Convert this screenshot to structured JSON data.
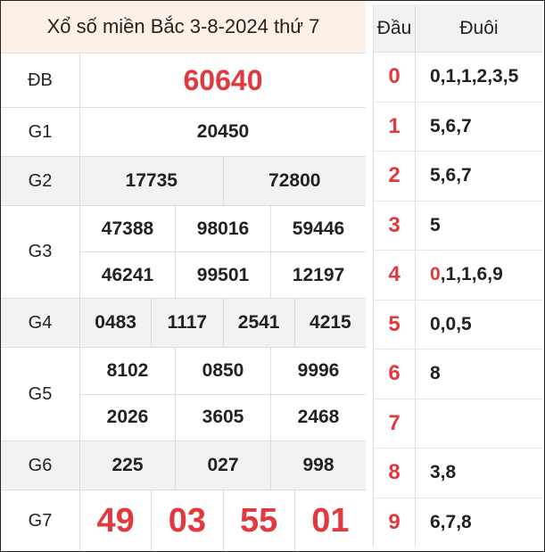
{
  "title": "Xổ số miền Bắc 3-8-2024 thứ 7",
  "prizes": {
    "db": {
      "label": "ĐB",
      "numbers": [
        "60640"
      ]
    },
    "g1": {
      "label": "G1",
      "numbers": [
        "20450"
      ]
    },
    "g2": {
      "label": "G2",
      "numbers": [
        "17735",
        "72800"
      ]
    },
    "g3": {
      "label": "G3",
      "numbers": [
        "47388",
        "98016",
        "59446",
        "46241",
        "99501",
        "12197"
      ]
    },
    "g4": {
      "label": "G4",
      "numbers": [
        "0483",
        "1117",
        "2541",
        "4215"
      ]
    },
    "g5": {
      "label": "G5",
      "numbers": [
        "8102",
        "0850",
        "9996",
        "2026",
        "3605",
        "2468"
      ]
    },
    "g6": {
      "label": "G6",
      "numbers": [
        "225",
        "027",
        "998"
      ]
    },
    "g7": {
      "label": "G7",
      "numbers": [
        "49",
        "03",
        "55",
        "01"
      ]
    }
  },
  "loto": {
    "head_label": "Đầu",
    "tail_label": "Đuôi",
    "rows": [
      {
        "head": "0",
        "tail_highlight": "",
        "tail": "0,1,1,2,3,5"
      },
      {
        "head": "1",
        "tail_highlight": "",
        "tail": "5,6,7"
      },
      {
        "head": "2",
        "tail_highlight": "",
        "tail": "5,6,7"
      },
      {
        "head": "3",
        "tail_highlight": "",
        "tail": "5"
      },
      {
        "head": "4",
        "tail_highlight": "0",
        "tail": ",1,1,6,9"
      },
      {
        "head": "5",
        "tail_highlight": "",
        "tail": "0,0,5"
      },
      {
        "head": "6",
        "tail_highlight": "",
        "tail": "8"
      },
      {
        "head": "7",
        "tail_highlight": "",
        "tail": ""
      },
      {
        "head": "8",
        "tail_highlight": "",
        "tail": "3,8"
      },
      {
        "head": "9",
        "tail_highlight": "",
        "tail": "6,7,8"
      }
    ]
  },
  "colors": {
    "accent": "#e0393e",
    "title_bg": "#fdf0e6",
    "stripe_bg": "#f2f2f2"
  }
}
